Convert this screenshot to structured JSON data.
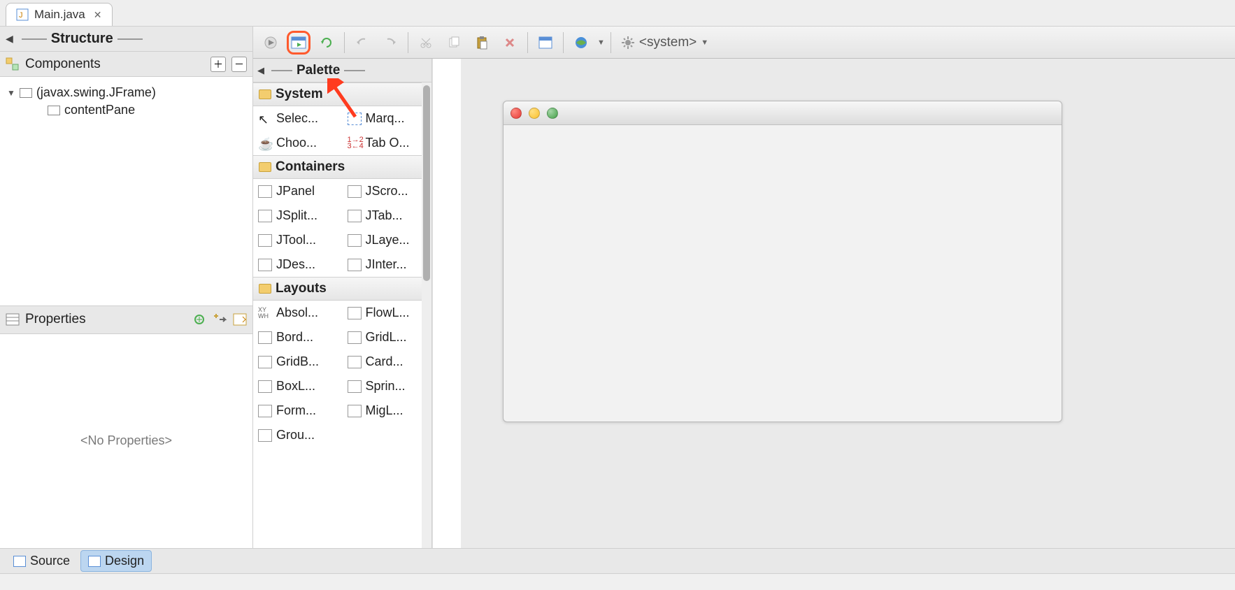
{
  "tab": {
    "title": "Main.java"
  },
  "structure": {
    "heading": "Structure",
    "components_label": "Components",
    "tree": {
      "root": "(javax.swing.JFrame)",
      "child": "contentPane"
    },
    "properties_label": "Properties",
    "no_properties": "<No Properties>"
  },
  "toolbar": {
    "system_label": "<system>"
  },
  "palette": {
    "heading": "Palette",
    "categories": [
      {
        "name": "System",
        "items": [
          {
            "label": "Selec..."
          },
          {
            "label": "Marq..."
          },
          {
            "label": "Choo..."
          },
          {
            "label": "Tab O..."
          }
        ]
      },
      {
        "name": "Containers",
        "items": [
          {
            "label": "JPanel"
          },
          {
            "label": "JScro..."
          },
          {
            "label": "JSplit..."
          },
          {
            "label": "JTab..."
          },
          {
            "label": "JTool..."
          },
          {
            "label": "JLaye..."
          },
          {
            "label": "JDes..."
          },
          {
            "label": "JInter..."
          }
        ]
      },
      {
        "name": "Layouts",
        "items": [
          {
            "label": "Absol..."
          },
          {
            "label": "FlowL..."
          },
          {
            "label": "Bord..."
          },
          {
            "label": "GridL..."
          },
          {
            "label": "GridB..."
          },
          {
            "label": "Card..."
          },
          {
            "label": "BoxL..."
          },
          {
            "label": "Sprin..."
          },
          {
            "label": "Form..."
          },
          {
            "label": "MigL..."
          },
          {
            "label": "Grou..."
          }
        ]
      }
    ]
  },
  "bottom_tabs": {
    "source": "Source",
    "design": "Design"
  }
}
